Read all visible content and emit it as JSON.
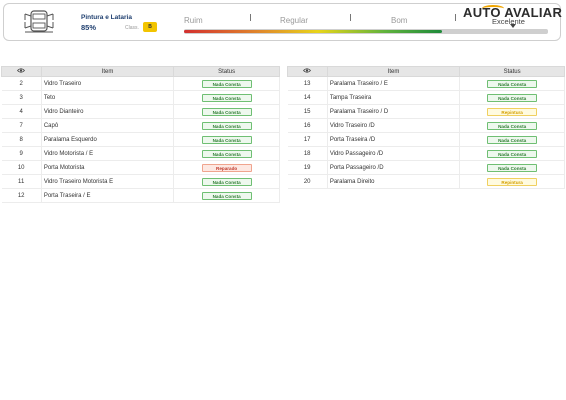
{
  "header": {
    "section_title": "Pintura e Lataria",
    "section_percent": "85%",
    "class_label": "Class.",
    "class_value": "B",
    "scale": [
      "Ruim",
      "Regular",
      "Bom"
    ],
    "score_fraction": 0.71,
    "brand": "AUTO AVALIAR",
    "rating": "Excelente",
    "icons": {
      "car": "car-body-icon"
    }
  },
  "colors": {
    "ok": "#2e7d32",
    "repaired": "#c0392b",
    "repaint": "#d5a000",
    "brand_accent": "#f0a500"
  },
  "table_headers": {
    "icon": "eye-icon",
    "item": "Item",
    "status": "Status"
  },
  "left_table": [
    {
      "num": "2",
      "item": "Vidro Traseiro",
      "status": "Nada Consta",
      "kind": "ok"
    },
    {
      "num": "3",
      "item": "Teto",
      "status": "Nada Consta",
      "kind": "ok"
    },
    {
      "num": "4",
      "item": "Vidro Dianteiro",
      "status": "Nada Consta",
      "kind": "ok"
    },
    {
      "num": "7",
      "item": "Capô",
      "status": "Nada Consta",
      "kind": "ok"
    },
    {
      "num": "8",
      "item": "Paralama Esquerdo",
      "status": "Nada Consta",
      "kind": "ok"
    },
    {
      "num": "9",
      "item": "Vidro Motorista / E",
      "status": "Nada Consta",
      "kind": "ok"
    },
    {
      "num": "10",
      "item": "Porta Motorista",
      "status": "Reparado",
      "kind": "repaired"
    },
    {
      "num": "11",
      "item": "Vidro Traseiro Motorista E",
      "status": "Nada Consta",
      "kind": "ok"
    },
    {
      "num": "12",
      "item": "Porta Traseira / E",
      "status": "Nada Consta",
      "kind": "ok"
    }
  ],
  "right_table": [
    {
      "num": "13",
      "item": "Paralama Traseiro / E",
      "status": "Nada Consta",
      "kind": "ok"
    },
    {
      "num": "14",
      "item": "Tampa Traseira",
      "status": "Nada Consta",
      "kind": "ok"
    },
    {
      "num": "15",
      "item": "Paralama Traseiro / D",
      "status": "Repintura",
      "kind": "repaint"
    },
    {
      "num": "16",
      "item": "Vidro Traseiro /D",
      "status": "Nada Consta",
      "kind": "ok"
    },
    {
      "num": "17",
      "item": "Porta Traseira /D",
      "status": "Nada Consta",
      "kind": "ok"
    },
    {
      "num": "18",
      "item": "Vidro Passageiro /D",
      "status": "Nada Consta",
      "kind": "ok"
    },
    {
      "num": "19",
      "item": "Porta Passageiro /D",
      "status": "Nada Consta",
      "kind": "ok"
    },
    {
      "num": "20",
      "item": "Paralama Direito",
      "status": "Repintura",
      "kind": "repaint"
    }
  ]
}
